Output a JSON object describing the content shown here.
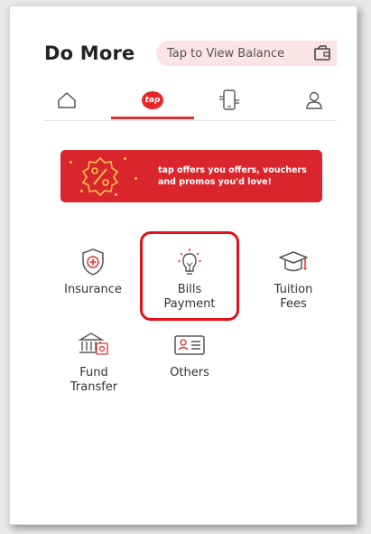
{
  "header": {
    "title": "Do More",
    "balance_label": "Tap to View Balance"
  },
  "tabs": [
    {
      "name": "home",
      "icon": "home-icon"
    },
    {
      "name": "tap",
      "icon": "tap-logo",
      "label": "tap",
      "active": true
    },
    {
      "name": "phone",
      "icon": "phone-icon"
    },
    {
      "name": "profile",
      "icon": "user-icon"
    }
  ],
  "banner": {
    "text_line1": "tap offers you offers, vouchers",
    "text_line2": "and promos you'd love!",
    "icon": "percent-badge-icon"
  },
  "services": [
    {
      "label_line1": "Insurance",
      "label_line2": "",
      "icon": "shield-plus-icon"
    },
    {
      "label_line1": "Bills",
      "label_line2": "Payment",
      "icon": "lightbulb-icon",
      "highlighted": true
    },
    {
      "label_line1": "Tuition",
      "label_line2": "Fees",
      "icon": "graduation-cap-icon"
    },
    {
      "label_line1": "Fund",
      "label_line2": "Transfer",
      "icon": "bank-transfer-icon"
    },
    {
      "label_line1": "Others",
      "label_line2": "",
      "icon": "id-card-icon"
    }
  ],
  "colors": {
    "accent": "#e03030",
    "banner": "#d9262c",
    "pill": "#fbe4e4"
  }
}
